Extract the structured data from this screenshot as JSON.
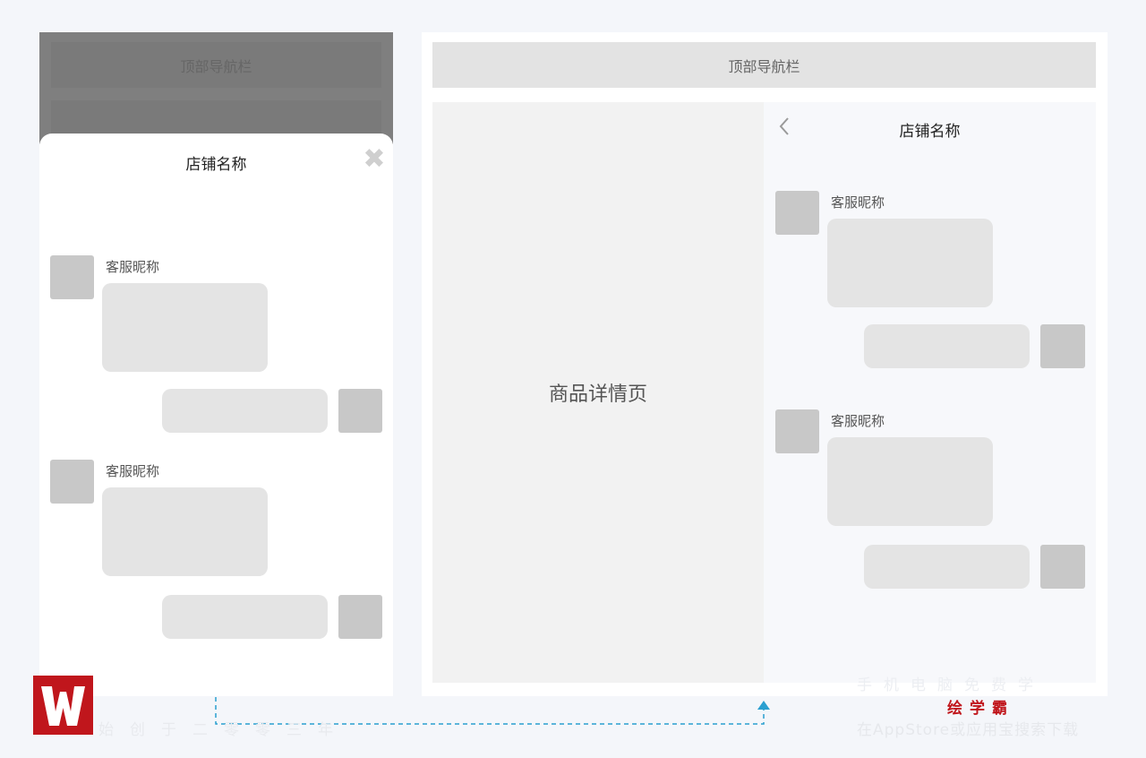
{
  "phone": {
    "nav_label": "顶部导航栏",
    "sheet_title": "店铺名称",
    "close_icon": "close-icon",
    "agent_nickname_1": "客服昵称",
    "agent_nickname_2": "客服昵称"
  },
  "desktop": {
    "nav_label": "顶部导航栏",
    "detail_label": "商品详情页",
    "chat_title": "店铺名称",
    "back_icon": "chevron-left-icon",
    "agent_nickname_1": "客服昵称",
    "agent_nickname_2": "客服昵称"
  },
  "branding": {
    "slogan_left": "始创于二零零三年",
    "slogan_right_1": "手机电脑免费学",
    "brand_name": "绘学霸",
    "slogan_right_2": "在AppStore或应用宝搜索下载",
    "logo_icon": "logo-w-icon",
    "accent_color": "#c0161c",
    "connector_color": "#2a9fd0"
  }
}
